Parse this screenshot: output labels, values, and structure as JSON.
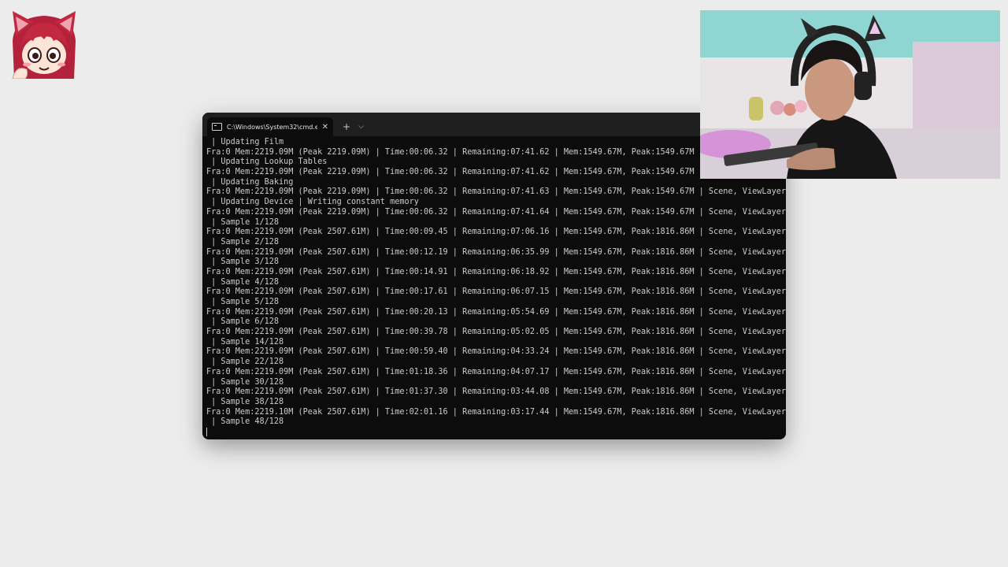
{
  "terminal": {
    "tab_title": "C:\\Windows\\System32\\cmd.e",
    "close_glyph": "✕",
    "new_tab_glyph": "+",
    "dropdown_glyph": "⌵",
    "lines": [
      " | Updating Film",
      "Fra:0 Mem:2219.09M (Peak 2219.09M) | Time:00:06.32 | Remaining:07:41.62 | Mem:1549.67M, Peak:1549.67M | Scene, ViewLayer",
      " | Updating Lookup Tables",
      "Fra:0 Mem:2219.09M (Peak 2219.09M) | Time:00:06.32 | Remaining:07:41.62 | Mem:1549.67M, Peak:1549.67M | Scene, ViewLayer",
      " | Updating Baking",
      "Fra:0 Mem:2219.09M (Peak 2219.09M) | Time:00:06.32 | Remaining:07:41.63 | Mem:1549.67M, Peak:1549.67M | Scene, ViewLayer",
      " | Updating Device | Writing constant memory",
      "Fra:0 Mem:2219.09M (Peak 2219.09M) | Time:00:06.32 | Remaining:07:41.64 | Mem:1549.67M, Peak:1549.67M | Scene, ViewLayer",
      " | Sample 1/128",
      "Fra:0 Mem:2219.09M (Peak 2507.61M) | Time:00:09.45 | Remaining:07:06.16 | Mem:1549.67M, Peak:1816.86M | Scene, ViewLayer",
      " | Sample 2/128",
      "Fra:0 Mem:2219.09M (Peak 2507.61M) | Time:00:12.19 | Remaining:06:35.99 | Mem:1549.67M, Peak:1816.86M | Scene, ViewLayer",
      " | Sample 3/128",
      "Fra:0 Mem:2219.09M (Peak 2507.61M) | Time:00:14.91 | Remaining:06:18.92 | Mem:1549.67M, Peak:1816.86M | Scene, ViewLayer",
      " | Sample 4/128",
      "Fra:0 Mem:2219.09M (Peak 2507.61M) | Time:00:17.61 | Remaining:06:07.15 | Mem:1549.67M, Peak:1816.86M | Scene, ViewLayer",
      " | Sample 5/128",
      "Fra:0 Mem:2219.09M (Peak 2507.61M) | Time:00:20.13 | Remaining:05:54.69 | Mem:1549.67M, Peak:1816.86M | Scene, ViewLayer",
      " | Sample 6/128",
      "Fra:0 Mem:2219.09M (Peak 2507.61M) | Time:00:39.78 | Remaining:05:02.05 | Mem:1549.67M, Peak:1816.86M | Scene, ViewLayer",
      " | Sample 14/128",
      "Fra:0 Mem:2219.09M (Peak 2507.61M) | Time:00:59.40 | Remaining:04:33.24 | Mem:1549.67M, Peak:1816.86M | Scene, ViewLayer",
      " | Sample 22/128",
      "Fra:0 Mem:2219.09M (Peak 2507.61M) | Time:01:18.36 | Remaining:04:07.17 | Mem:1549.67M, Peak:1816.86M | Scene, ViewLayer",
      " | Sample 30/128",
      "Fra:0 Mem:2219.09M (Peak 2507.61M) | Time:01:37.30 | Remaining:03:44.08 | Mem:1549.67M, Peak:1816.86M | Scene, ViewLayer",
      " | Sample 38/128",
      "Fra:0 Mem:2219.10M (Peak 2507.61M) | Time:02:01.16 | Remaining:03:17.44 | Mem:1549.67M, Peak:1816.86M | Scene, ViewLayer",
      " | Sample 48/128"
    ]
  },
  "colors": {
    "desktop_bg": "#ececec",
    "terminal_bg": "#0c0c0c",
    "terminal_text": "#cccccc",
    "titlebar_bg": "#1f1f1f"
  },
  "icons": {
    "corner_logo": "anime-cat-girl-avatar-icon",
    "tab_icon": "terminal-icon"
  }
}
